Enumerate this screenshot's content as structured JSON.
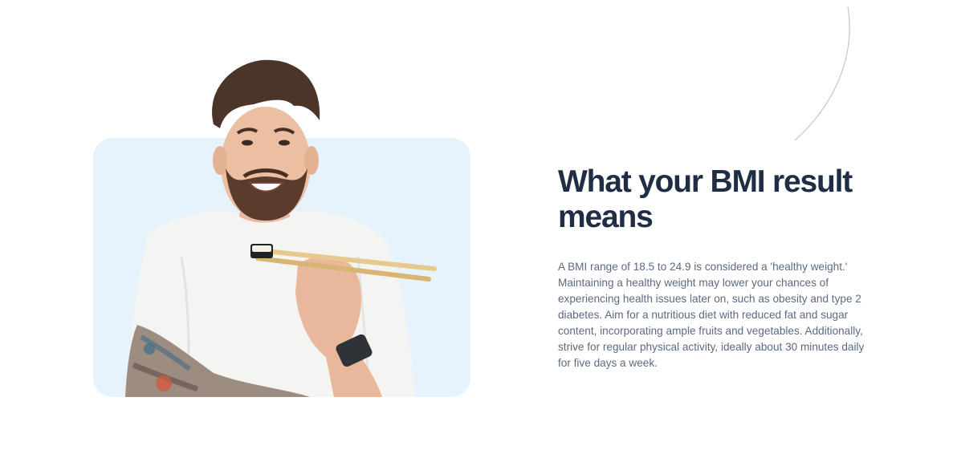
{
  "section": {
    "title": "What your BMI result means",
    "body": "A BMI range of 18.5 to 24.9 is considered a 'healthy weight.' Maintaining a healthy weight may lower your chances of experiencing health issues later on, such as obesity and type 2 diabetes. Aim for a nutritious diet with reduced fat and sugar content, incorporating ample fruits and vegetables. Additionally, strive for regular physical activity, ideally about 30 minutes daily for five days a week."
  },
  "colors": {
    "title": "#1f2d45",
    "body_text": "#5c6a80",
    "panel_background": "#e6f3fd",
    "decor_arc": "#b9c9dc"
  },
  "image": {
    "subject": "smiling-man-eating-sushi-with-chopsticks"
  }
}
